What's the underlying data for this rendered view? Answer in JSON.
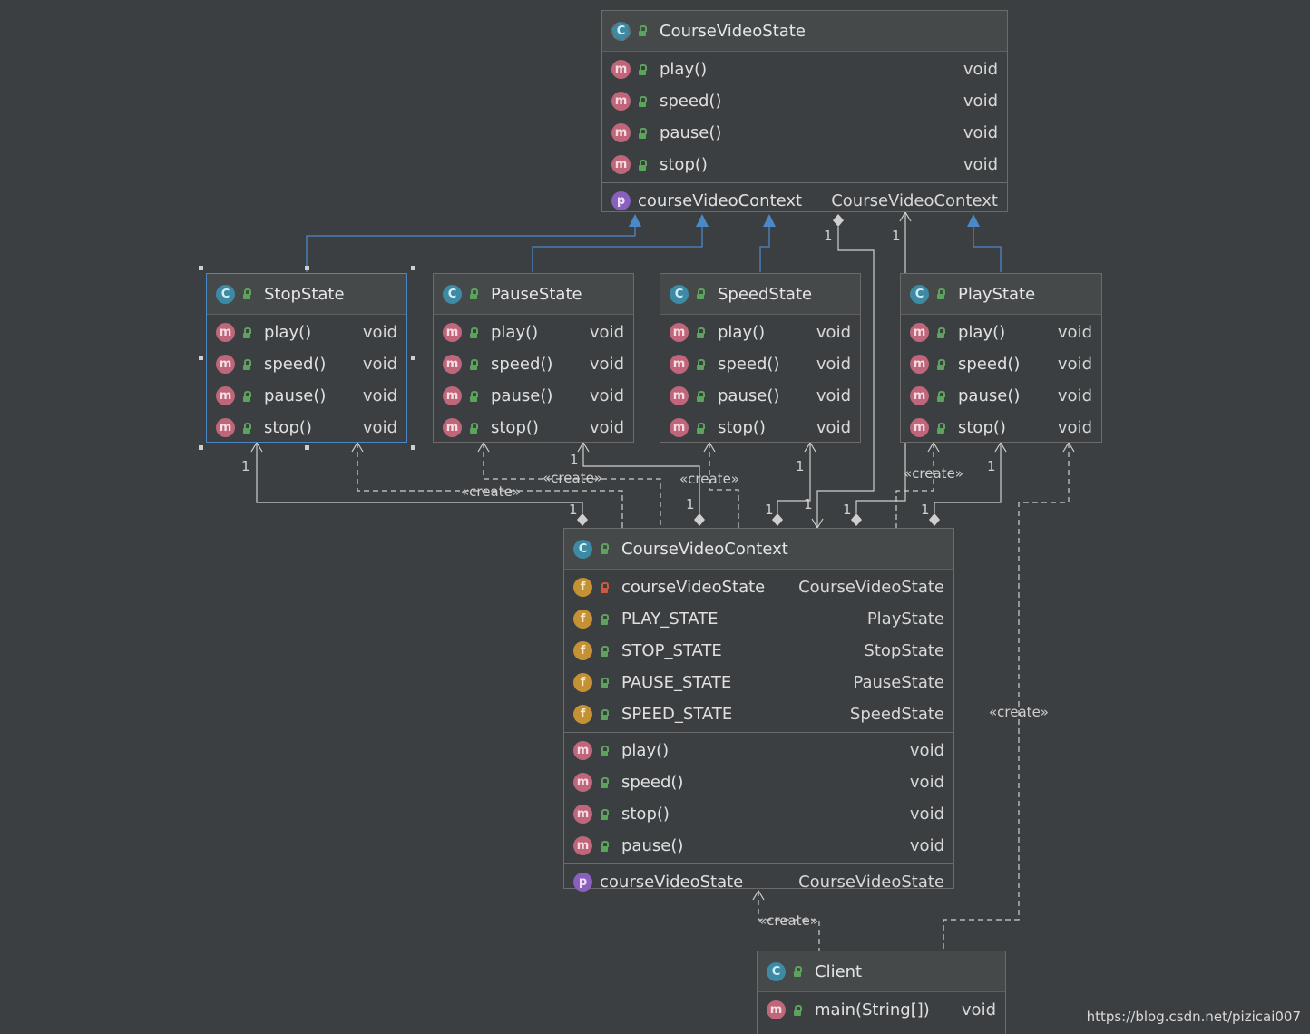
{
  "classes": {
    "course_video_state": {
      "title": "CourseVideoState",
      "methods": [
        {
          "name": "play()",
          "type": "void"
        },
        {
          "name": "speed()",
          "type": "void"
        },
        {
          "name": "pause()",
          "type": "void"
        },
        {
          "name": "stop()",
          "type": "void"
        }
      ],
      "properties": [
        {
          "name": "courseVideoContext",
          "type": "CourseVideoContext"
        }
      ]
    },
    "stop_state": {
      "title": "StopState",
      "methods": [
        {
          "name": "play()",
          "type": "void"
        },
        {
          "name": "speed()",
          "type": "void"
        },
        {
          "name": "pause()",
          "type": "void"
        },
        {
          "name": "stop()",
          "type": "void"
        }
      ]
    },
    "pause_state": {
      "title": "PauseState",
      "methods": [
        {
          "name": "play()",
          "type": "void"
        },
        {
          "name": "speed()",
          "type": "void"
        },
        {
          "name": "pause()",
          "type": "void"
        },
        {
          "name": "stop()",
          "type": "void"
        }
      ]
    },
    "speed_state": {
      "title": "SpeedState",
      "methods": [
        {
          "name": "play()",
          "type": "void"
        },
        {
          "name": "speed()",
          "type": "void"
        },
        {
          "name": "pause()",
          "type": "void"
        },
        {
          "name": "stop()",
          "type": "void"
        }
      ]
    },
    "play_state": {
      "title": "PlayState",
      "methods": [
        {
          "name": "play()",
          "type": "void"
        },
        {
          "name": "speed()",
          "type": "void"
        },
        {
          "name": "pause()",
          "type": "void"
        },
        {
          "name": "stop()",
          "type": "void"
        }
      ]
    },
    "course_video_context": {
      "title": "CourseVideoContext",
      "fields": [
        {
          "name": "courseVideoState",
          "type": "CourseVideoState"
        },
        {
          "name": "PLAY_STATE",
          "type": "PlayState"
        },
        {
          "name": "STOP_STATE",
          "type": "StopState"
        },
        {
          "name": "PAUSE_STATE",
          "type": "PauseState"
        },
        {
          "name": "SPEED_STATE",
          "type": "SpeedState"
        }
      ],
      "methods": [
        {
          "name": "play()",
          "type": "void"
        },
        {
          "name": "speed()",
          "type": "void"
        },
        {
          "name": "stop()",
          "type": "void"
        },
        {
          "name": "pause()",
          "type": "void"
        }
      ],
      "properties": [
        {
          "name": "courseVideoState",
          "type": "CourseVideoState"
        }
      ]
    },
    "client": {
      "title": "Client",
      "methods": [
        {
          "name": "main(String[])",
          "type": "void"
        }
      ]
    }
  },
  "icons": {
    "class": "C",
    "method": "m",
    "field": "f",
    "property": "p"
  },
  "labels": {
    "create": "«create»",
    "one": "1"
  },
  "watermark": "https://blog.csdn.net/pizicai007",
  "colors": {
    "inheritance": "#4a88c7",
    "association": "#cfcfcf",
    "background": "#3c3f41"
  }
}
